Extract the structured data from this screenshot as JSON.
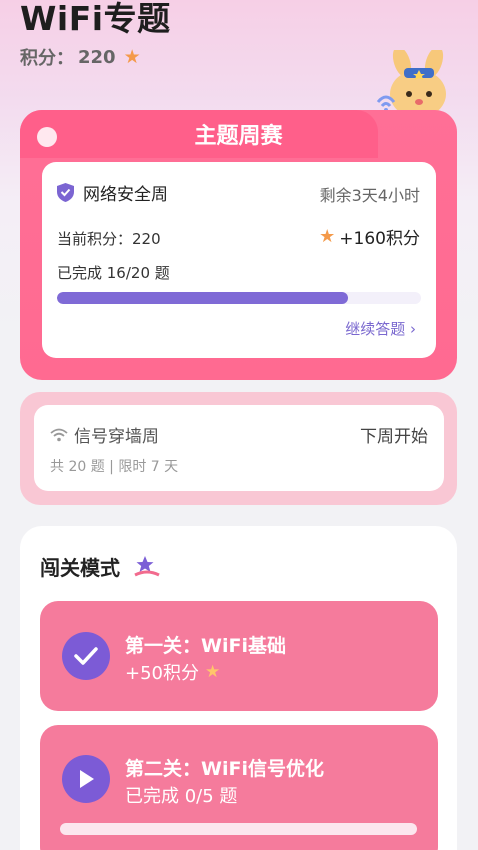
{
  "header": {
    "title": "WiFi专题",
    "points_label": "积分：",
    "points_value": "220"
  },
  "weekly": {
    "title": "主题周赛",
    "topic": "网络安全周",
    "remaining": "剩余3天4小时",
    "current_points": "当前积分：220",
    "bonus": "+160积分",
    "completed": "已完成 16/20 题",
    "progress": 0.8,
    "continue": "继续答题 ›"
  },
  "next_week": {
    "topic": "信号穿墙周",
    "start": "下周开始",
    "meta": "共 20 题 | 限时 7 天"
  },
  "levels": {
    "heading": "闯关模式",
    "items": [
      {
        "title": "第一关：WiFi基础",
        "sub": "+50积分",
        "status": "done"
      },
      {
        "title": "第二关：WiFi信号优化",
        "sub": "已完成 0/5 题",
        "status": "play",
        "progress": 0
      }
    ]
  },
  "colors": {
    "accent_pink": "#ff6a91",
    "accent_purple": "#7f6ad6",
    "star": "#f49a4a"
  }
}
